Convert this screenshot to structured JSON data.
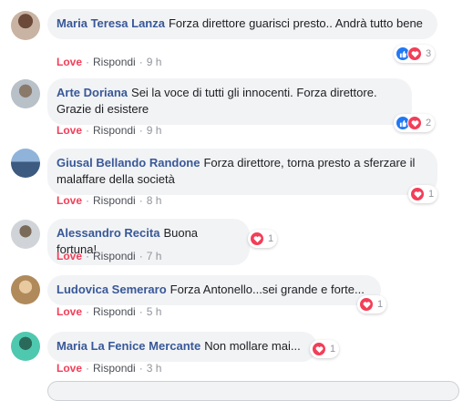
{
  "comments": [
    {
      "author": "Maria Teresa Lanza",
      "text": "Forza direttore guarisci presto.. Andrà tutto bene",
      "love": "Love",
      "reply": "Rispondi",
      "time": "9 h",
      "reaction_count": "3",
      "reactions": [
        "like",
        "love"
      ]
    },
    {
      "author": "Arte Doriana",
      "text": "Sei la voce di tutti gli innocenti. Forza direttore. Grazie di esistere",
      "love": "Love",
      "reply": "Rispondi",
      "time": "9 h",
      "reaction_count": "2",
      "reactions": [
        "like",
        "love"
      ]
    },
    {
      "author": "Giusal Bellando Randone",
      "text": "Forza direttore, torna presto a sferzare il malaffare della società",
      "love": "Love",
      "reply": "Rispondi",
      "time": "8 h",
      "reaction_count": "1",
      "reactions": [
        "love"
      ]
    },
    {
      "author": "Alessandro Recita",
      "text": "Buona fortuna!",
      "love": "Love",
      "reply": "Rispondi",
      "time": "7 h",
      "reaction_count": "1",
      "reactions": [
        "love"
      ]
    },
    {
      "author": "Ludovica Semeraro",
      "text": "Forza Antonello...sei grande e forte...",
      "love": "Love",
      "reply": "Rispondi",
      "time": "5 h",
      "reaction_count": "1",
      "reactions": [
        "love"
      ]
    },
    {
      "author": "Maria La Fenice Mercante",
      "text": "Non mollare mai...",
      "love": "Love",
      "reply": "Rispondi",
      "time": "3 h",
      "reaction_count": "1",
      "reactions": [
        "love"
      ]
    }
  ],
  "separator": "·",
  "colors": {
    "author": "#385898",
    "love": "#f33e58",
    "like": "#2078f4",
    "bubble": "#f2f3f5",
    "meta": "#90949c"
  },
  "icons": {
    "like": "thumbs-up-icon",
    "love": "heart-icon"
  }
}
